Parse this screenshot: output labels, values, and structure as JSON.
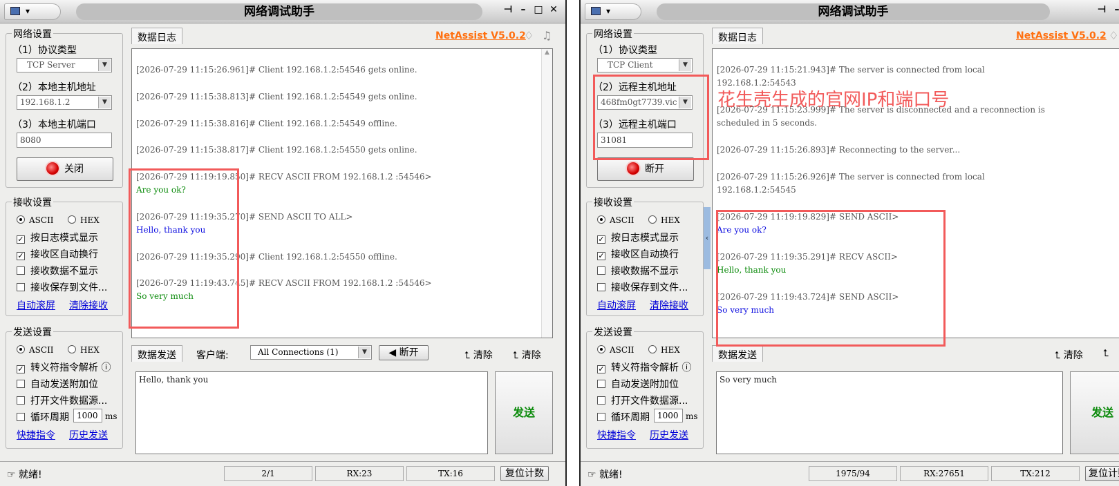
{
  "title": "网络调试助手",
  "brand": "NetAssist V5.0.2",
  "labels": {
    "net_settings": "网络设置",
    "protocol": "（1）协议类型",
    "recv_settings": "接收设置",
    "send_settings": "发送设置",
    "log_tab": "数据日志",
    "send_tab": "数据发送",
    "ascii": "ASCII",
    "hex": "HEX",
    "log_mode": "按日志模式显示",
    "auto_wrap": "接收区自动换行",
    "no_show": "接收数据不显示",
    "save_file": "接收保存到文件...",
    "auto_scroll": "自动滚屏",
    "clear_recv": "清除接收",
    "escape": "转义符指令解析",
    "auto_append": "自动发送附加位",
    "open_file": "打开文件数据源...",
    "loop": "循环周期",
    "loop_val": "1000",
    "ms": "ms",
    "shortcut": "快捷指令",
    "history": "历史发送",
    "clear": "清除",
    "send": "发送",
    "ready": "就绪!",
    "reset": "复位计数"
  },
  "left": {
    "protocol": "TCP Server",
    "host_label": "（2）本地主机地址",
    "host": "192.168.1.2",
    "port_label": "（3）本地主机端口",
    "port": "8080",
    "conn_btn": "关闭",
    "client_label": "客户端:",
    "client_sel": "All Connections (1)",
    "disconnect": "断开",
    "log": [
      {
        "t": "[2026-07-29 11:15:26.961]# Client 192.168.1.2:54546 gets online."
      },
      {
        "t": "[2026-07-29 11:15:38.813]# Client 192.168.1.2:54549 gets online."
      },
      {
        "t": "[2026-07-29 11:15:38.816]# Client 192.168.1.2:54549 offline."
      },
      {
        "t": "[2026-07-29 11:15:38.817]# Client 192.168.1.2:54550 gets online."
      },
      {
        "t": "[2026-07-29 11:19:19.850]# RECV ASCII FROM 192.168.1.2 :54546>",
        "m": "Are you ok?",
        "c": "g"
      },
      {
        "t": "[2026-07-29 11:19:35.270]# SEND ASCII TO ALL>",
        "m": "Hello, thank you",
        "c": "b"
      },
      {
        "t": "[2026-07-29 11:19:35.290]# Client 192.168.1.2:54550 offline."
      },
      {
        "t": "[2026-07-29 11:19:43.745]# RECV ASCII FROM 192.168.1.2 :54546>",
        "m": "So very much",
        "c": "g"
      }
    ],
    "send_text": "Hello, thank you",
    "status": {
      "count": "2/1",
      "rx": "RX:23",
      "tx": "TX:16"
    }
  },
  "right": {
    "protocol": "TCP Client",
    "host_label": "（2）远程主机地址",
    "host": "468fm0gt7739.vic",
    "port_label": "（3）远程主机端口",
    "port": "31081",
    "conn_btn": "断开",
    "log": [
      {
        "t": "[2026-07-29 11:15:21.943]# The server is connected from local\n192.168.1.2:54543"
      },
      {
        "t": "[2026-07-29 11:15:23.999]# The server is disconnected and a reconnection is\nscheduled in 5 seconds."
      },
      {
        "t": "[2026-07-29 11:15:26.893]# Reconnecting to the server..."
      },
      {
        "t": "[2026-07-29 11:15:26.926]# The server is connected from local\n192.168.1.2:54545"
      },
      {
        "t": "[2026-07-29 11:19:19.829]# SEND ASCII>",
        "m": "Are you ok?",
        "c": "b"
      },
      {
        "t": "[2026-07-29 11:19:35.291]# RECV ASCII>",
        "m": "Hello, thank you",
        "c": "g"
      },
      {
        "t": "[2026-07-29 11:19:43.724]# SEND ASCII>",
        "m": "So very much",
        "c": "b"
      }
    ],
    "send_text": "So very much",
    "status": {
      "count": "1975/94",
      "rx": "RX:27651",
      "tx": "TX:212"
    }
  },
  "annotation": "花生壳生成的官网IP和端口号"
}
